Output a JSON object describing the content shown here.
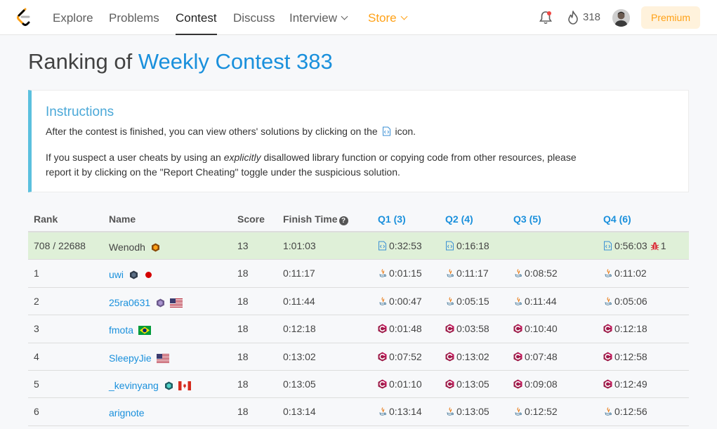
{
  "nav": {
    "items": [
      {
        "label": "Explore"
      },
      {
        "label": "Problems"
      },
      {
        "label": "Contest"
      },
      {
        "label": "Discuss"
      },
      {
        "label": "Interview"
      },
      {
        "label": "Store"
      }
    ],
    "streak_count": "318",
    "premium_label": "Premium",
    "brand_color": "#ffa116",
    "icons": [
      "logo-icon",
      "bell-icon",
      "flame-icon",
      "avatar"
    ]
  },
  "title": {
    "prefix": "Ranking of",
    "contest_name": "Weekly Contest 383"
  },
  "instructions": {
    "heading": "Instructions",
    "p1_before": "After the contest is finished, you can view others' solutions by clicking on the",
    "p1_after": "icon.",
    "p2_before": "If you suspect a user cheats by using an",
    "p2_emphasis": "explicitly",
    "p2_after": "disallowed library function or copying code from other resources, please report it by clicking on the \"Report Cheating\" toggle under the suspicious solution."
  },
  "table": {
    "headers": {
      "rank": "Rank",
      "name": "Name",
      "score": "Score",
      "finish_time": "Finish Time",
      "q1": "Q1 (3)",
      "q2": "Q2 (4)",
      "q3": "Q3 (5)",
      "q4": "Q4 (6)"
    },
    "rows": [
      {
        "rank": "708 / 22688",
        "name": "Wenodh",
        "score": "13",
        "finish": "1:01:03",
        "badge": "orange",
        "flag": "",
        "q1": "0:32:53",
        "q2": "0:16:18",
        "q3": "",
        "q4": "0:56:03",
        "q4_bugs": "1",
        "lang": "code"
      },
      {
        "rank": "1",
        "name": "uwi",
        "score": "18",
        "finish": "0:11:17",
        "badge": "dark",
        "flag": "japan",
        "q1": "0:01:15",
        "q2": "0:11:17",
        "q3": "0:08:52",
        "q4": "0:11:02",
        "lang": "java"
      },
      {
        "rank": "2",
        "name": "25ra0631",
        "score": "18",
        "finish": "0:11:44",
        "badge": "purple",
        "flag": "usa",
        "q1": "0:00:47",
        "q2": "0:05:15",
        "q3": "0:11:44",
        "q4": "0:05:06",
        "lang": "java"
      },
      {
        "rank": "3",
        "name": "fmota",
        "score": "18",
        "finish": "0:12:18",
        "badge": "",
        "flag": "brazil",
        "q1": "0:01:48",
        "q2": "0:03:58",
        "q3": "0:10:40",
        "q4": "0:12:18",
        "lang": "cpp"
      },
      {
        "rank": "4",
        "name": "SleepyJie",
        "score": "18",
        "finish": "0:13:02",
        "badge": "",
        "flag": "usa",
        "q1": "0:07:52",
        "q2": "0:13:02",
        "q3": "0:07:48",
        "q4": "0:12:58",
        "lang": "cpp"
      },
      {
        "rank": "5",
        "name": "_kevinyang",
        "score": "18",
        "finish": "0:13:05",
        "badge": "teal",
        "flag": "canada",
        "q1": "0:01:10",
        "q2": "0:13:05",
        "q3": "0:09:08",
        "q4": "0:12:49",
        "lang": "cpp"
      },
      {
        "rank": "6",
        "name": "arignote",
        "score": "18",
        "finish": "0:13:14",
        "badge": "",
        "flag": "",
        "q1": "0:13:14",
        "q2": "0:13:05",
        "q3": "0:12:52",
        "q4": "0:12:56",
        "lang": "java"
      }
    ]
  }
}
